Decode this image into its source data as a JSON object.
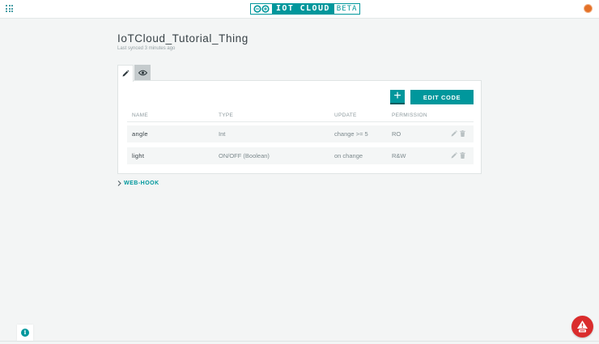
{
  "header": {
    "logo_title": "IOT CLOUD",
    "logo_badge": "BETA"
  },
  "thing": {
    "title": "IoTCloud_Tutorial_Thing",
    "sync_status": "Last synced 3 minutes ago"
  },
  "tabs": [
    {
      "icon": "pencil-icon",
      "selected": true
    },
    {
      "icon": "eye-icon",
      "selected": false
    }
  ],
  "toolbar": {
    "add_label": "+",
    "edit_code_label": "EDIT CODE"
  },
  "table": {
    "columns": [
      "NAME",
      "TYPE",
      "UPDATE",
      "PERMISSION"
    ],
    "rows": [
      {
        "name": "angle",
        "type": "Int",
        "update": "change >= 5",
        "permission": "RO"
      },
      {
        "name": "light",
        "type": "ON/OFF (Boolean)",
        "update": "on change",
        "permission": "R&W"
      }
    ]
  },
  "webhook": {
    "label": "WEB-HOOK"
  },
  "colors": {
    "accent": "#00979c",
    "background": "#f3f5f5",
    "bug_button": "#da2c2c",
    "avatar": "#e47128"
  }
}
